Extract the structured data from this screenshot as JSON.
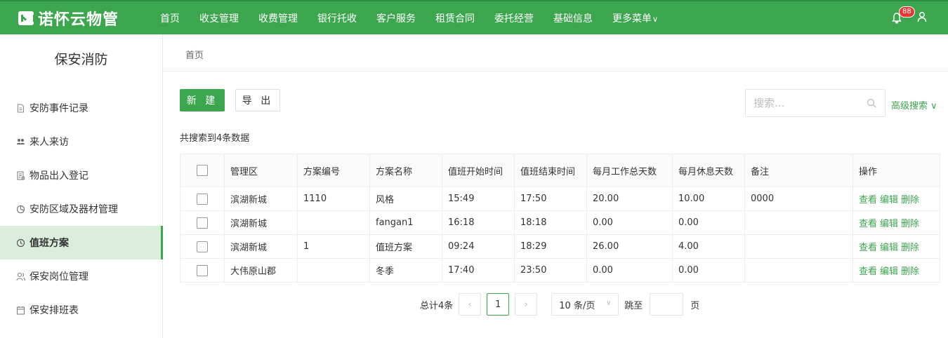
{
  "app": {
    "brand": "诺怀云物管",
    "notification_count": "88"
  },
  "nav": [
    "首页",
    "收支管理",
    "收费管理",
    "银行托收",
    "客户服务",
    "租赁合同",
    "委托经营",
    "基础信息",
    "更多菜单"
  ],
  "sidebar": {
    "title": "保安消防",
    "items": [
      {
        "label": "安防事件记录",
        "icon": "document-icon"
      },
      {
        "label": "来人来访",
        "icon": "visitors-icon"
      },
      {
        "label": "物品出入登记",
        "icon": "register-icon"
      },
      {
        "label": "安防区域及器材管理",
        "icon": "area-icon"
      },
      {
        "label": "值班方案",
        "icon": "duty-icon",
        "active": true
      },
      {
        "label": "保安岗位管理",
        "icon": "people-icon"
      },
      {
        "label": "保安排班表",
        "icon": "schedule-icon"
      }
    ]
  },
  "breadcrumb": "首页",
  "toolbar": {
    "new_label": "新 建",
    "export_label": "导 出",
    "search_placeholder": "搜索...",
    "advanced_search": "高级搜索"
  },
  "result_text": "共搜索到4条数据",
  "table": {
    "headers": [
      "管理区",
      "方案编号",
      "方案名称",
      "值班开始时间",
      "值班结束时间",
      "每月工作总天数",
      "每月休息天数",
      "备注",
      "操作"
    ],
    "rows": [
      [
        "滨湖新城",
        "1110",
        "风格",
        "15:49",
        "17:50",
        "20.00",
        "10.00",
        "0000"
      ],
      [
        "滨湖新城",
        "",
        "fangan1",
        "16:18",
        "18:18",
        "0.00",
        "0.00",
        ""
      ],
      [
        "滨湖新城",
        "1",
        "值班方案",
        "09:24",
        "18:29",
        "26.00",
        "4.00",
        ""
      ],
      [
        "大伟原山郡",
        "",
        "冬季",
        "17:40",
        "23:50",
        "0.00",
        "0.00",
        ""
      ]
    ],
    "actions": [
      "查看",
      "编辑",
      "删除"
    ]
  },
  "pagination": {
    "total": "总计4条",
    "prev": "‹",
    "current_page": "1",
    "next": "›",
    "page_size": "10 条/页",
    "jump_label": "跳至",
    "page_unit": "页"
  },
  "colors": {
    "primary": "#3ba64d",
    "active_bg": "#dbeedd",
    "badge": "#e53935"
  }
}
